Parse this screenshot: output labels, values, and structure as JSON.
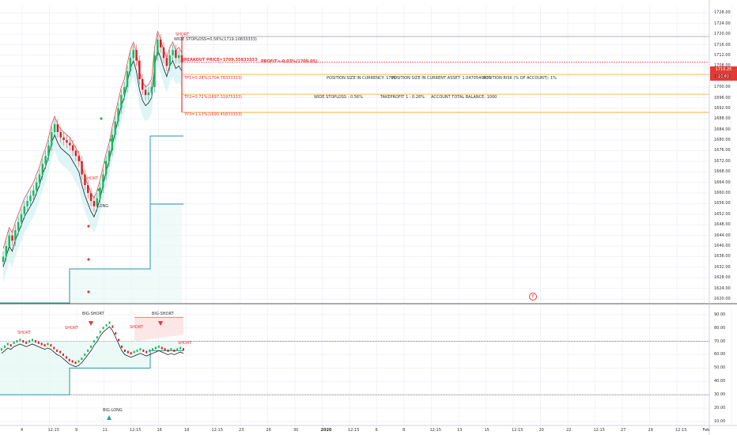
{
  "chart_data": [
    {
      "type": "line",
      "name": "price-panel",
      "y_ticks": [
        1728.0,
        1724.0,
        1720.0,
        1716.0,
        1712.0,
        1708.0,
        1704.0,
        1700.0,
        1696.0,
        1692.0,
        1688.0,
        1684.0,
        1680.0,
        1676.0,
        1672.0,
        1668.0,
        1664.0,
        1660.0,
        1656.0,
        1652.0,
        1648.0,
        1644.0,
        1640.0,
        1636.0,
        1632.0,
        1628.0,
        1624.0,
        1620.0
      ],
      "ylim": [
        1618.5,
        1730.5
      ],
      "current_price": "1710.25",
      "current_time": "10:49",
      "candles_close": [
        1636,
        1640,
        1644,
        1642,
        1646,
        1649,
        1652,
        1655,
        1657,
        1659,
        1661,
        1664,
        1667,
        1671,
        1674,
        1678,
        1683,
        1686,
        1683,
        1681,
        1680,
        1679,
        1678,
        1676,
        1674,
        1672,
        1667,
        1663,
        1660,
        1657,
        1655,
        1658,
        1662,
        1667,
        1672,
        1676,
        1682,
        1687,
        1692,
        1697,
        1700,
        1706,
        1711,
        1714,
        1710,
        1703,
        1699,
        1697,
        1698,
        1700,
        1712,
        1718,
        1715,
        1711,
        1708,
        1712,
        1714,
        1711,
        1712,
        1710
      ],
      "levels": {
        "wide_stoploss": {
          "label": "WIDE STOPLOSS=0.56%(1719.10833333)",
          "value": 1719.11
        },
        "breakout": {
          "label": "BREAKOUT PRICE=1709.35833333",
          "value": 1709.36
        },
        "profit": {
          "label": "PROFIT=-0.03%(1709.05)"
        },
        "tp1": {
          "label": "TP1=0.28%(1704.78333333)",
          "value": 1704.78
        },
        "tp2": {
          "label": "TP2=0.72%(1697.31975333)",
          "value": 1697.32
        },
        "tp3": {
          "label": "TP3=1.13%(1690.45833333)",
          "value": 1690.46
        }
      },
      "info": {
        "size_currency": "POSITION SIZE IN CURRENCY: 1790",
        "size_asset": "POSITION SIZE IN CURRENT ASSET: 1.0470540637",
        "risk": "POSITION RISK (% OF ACCOUNT): 1%",
        "wide_sl": "WIDE STOPLOSS : 0.56%",
        "takeprofit": "TAKEPROFIT 1 : 0.28%",
        "balance": "ACCOUNT TOTAL BALANCE: 1000"
      },
      "signals": {
        "short_top": "SHORT",
        "short_mid": "SHORT",
        "long_mid": "LONG"
      },
      "event_marker": "E"
    },
    {
      "type": "line",
      "name": "oscillator-panel",
      "y_ticks": [
        90.0,
        80.0,
        70.0,
        60.0,
        50.0,
        40.0,
        30.0,
        20.0,
        10.0
      ],
      "ylim": [
        7,
        97
      ],
      "levels": [
        70,
        30
      ],
      "osc": [
        64,
        66,
        68,
        67,
        69,
        70,
        71,
        70,
        69,
        70,
        71,
        70,
        69,
        68,
        67,
        68,
        67,
        65,
        63,
        62,
        60,
        58,
        56,
        55,
        54,
        55,
        57,
        60,
        63,
        66,
        70,
        73,
        77,
        80,
        82,
        84,
        81,
        76,
        71,
        66,
        63,
        62,
        61,
        62,
        63,
        64,
        63,
        62,
        63,
        64,
        65,
        66,
        65,
        64,
        63,
        64,
        63,
        64,
        65,
        64
      ],
      "signals": {
        "big_short_1": "BIG-SHORT",
        "big_short_2": "BIG-SHORT",
        "big_long": "BIG-LONG",
        "short_a": "SHORT",
        "short_b": "SHORT",
        "short_c": "SHORT",
        "short_d": "SHORT"
      }
    }
  ],
  "x_axis": [
    "4",
    "12:15",
    "9",
    "11",
    "12:15",
    "16",
    "18",
    "12:15",
    "23",
    "26",
    "30",
    "2020",
    "12:15",
    "6",
    "8",
    "12:15",
    "13",
    "15",
    "12:15",
    "20",
    "22",
    "12:15",
    "27",
    "29",
    "12:15",
    "Feb"
  ]
}
